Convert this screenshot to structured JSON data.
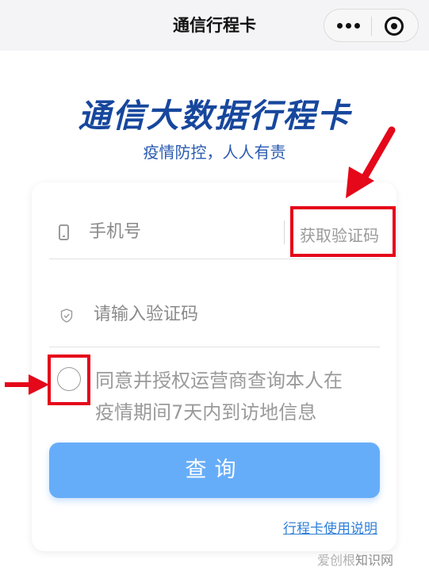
{
  "navbar": {
    "title": "通信行程卡"
  },
  "hero": {
    "title": "通信大数据行程卡",
    "subtitle": "疫情防控，人人有责"
  },
  "form": {
    "phone_placeholder": "手机号",
    "get_code_label": "获取验证码",
    "code_placeholder": "请输入验证码",
    "consent_line1": "同意并授权运营商查询本人在",
    "consent_line2": "疫情期间7天内到访地信息",
    "consent_checked": false,
    "submit_label": "查询",
    "help_link": "行程卡使用说明"
  },
  "watermark": {
    "part1": "爱创根",
    "part2": "知识网"
  },
  "colors": {
    "brand_blue": "#17479d",
    "button_blue": "#66adf9",
    "link_blue": "#2f7fd8",
    "highlight_red": "#e5071a"
  },
  "icons": {
    "phone": "phone-icon",
    "shield": "shield-check-icon",
    "more": "more-dots-icon",
    "close": "target-circle-icon"
  }
}
